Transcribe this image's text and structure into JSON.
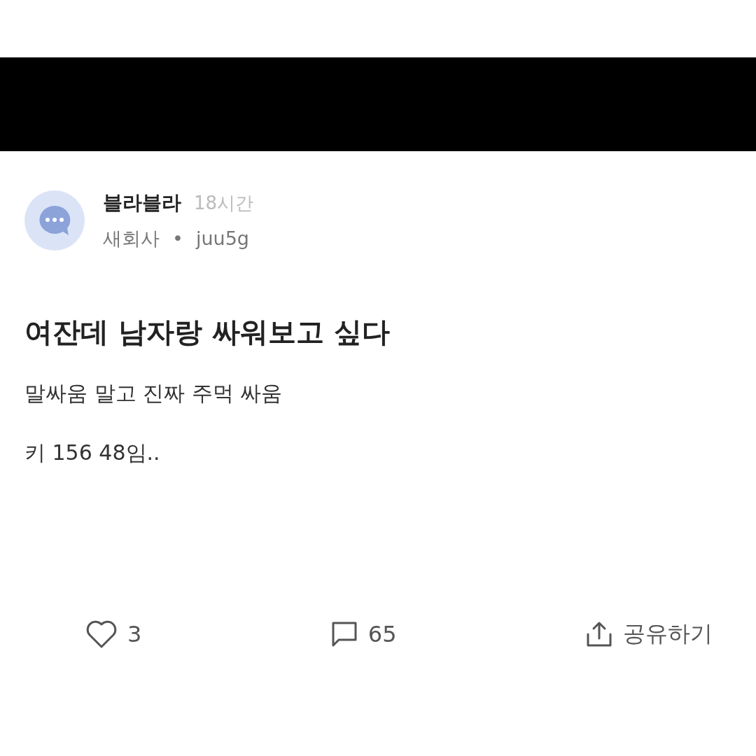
{
  "author": {
    "name": "블라블라",
    "time": "18시간",
    "company": "새회사",
    "separator": "•",
    "user_id": "juu5g"
  },
  "post": {
    "title": "여잔데 남자랑 싸워보고 싶다",
    "lines": [
      "말싸움 말고 진짜 주먹 싸움",
      "키 156 48임.."
    ]
  },
  "actions": [
    {
      "kind": "like",
      "label": "3"
    },
    {
      "kind": "comment",
      "label": "65"
    },
    {
      "kind": "share",
      "label": "공유하기"
    }
  ]
}
